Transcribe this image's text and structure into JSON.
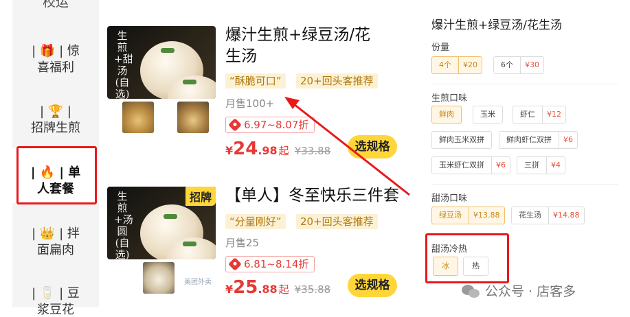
{
  "sidebar": {
    "cut_label": "校运",
    "items": [
      {
        "emoji": "🎁",
        "line1": "惊",
        "line2": "喜福利",
        "active": false
      },
      {
        "emoji": "🏆",
        "line1": "",
        "line2": "招牌生煎",
        "active": false
      },
      {
        "emoji": "🔥",
        "line1": "单",
        "line2": "人套餐",
        "active": true
      },
      {
        "emoji": "👑",
        "line1": "拌",
        "line2": "面扁肉",
        "active": false
      },
      {
        "emoji": "🥛",
        "line1": "豆",
        "line2": "浆豆花",
        "active": false
      }
    ]
  },
  "products": [
    {
      "title_line1": "爆汁生煎+绿豆汤/花",
      "title_line2": "生汤",
      "image_text": "生煎+甜汤(自选)",
      "tags": [
        "“酥脆可口”",
        "20+回头客推荐"
      ],
      "sales": "月售100+",
      "discount": "6.97~8.07折",
      "price_symbol": "¥",
      "price_int": "24",
      "price_dec": ".98",
      "price_unit": "起",
      "price_original": "¥33.88",
      "button": "选规格"
    },
    {
      "badge": "招牌",
      "title_line1": "【单人】冬至快乐三件套",
      "image_text": "生煎+汤圆(自选)",
      "thumb_text": "美团外卖",
      "tags": [
        "“分量刚好”",
        "20+回头客推荐"
      ],
      "sales": "月售25",
      "discount": "6.81~8.14折",
      "price_symbol": "¥",
      "price_int": "25",
      "price_dec": ".88",
      "price_unit": "起",
      "price_original": "¥35.88",
      "button": "选规格"
    }
  ],
  "spec": {
    "title": "爆汁生煎+绿豆汤/花生汤",
    "groups": {
      "portion": {
        "label": "份量",
        "options": [
          {
            "name": "4个",
            "price": "¥20",
            "selected": true
          },
          {
            "name": "6个",
            "price": "¥30",
            "selected": false
          }
        ]
      },
      "flavor": {
        "label": "生煎口味",
        "options": [
          {
            "name": "鲜肉",
            "price": "",
            "selected": true
          },
          {
            "name": "玉米",
            "price": "",
            "selected": false
          },
          {
            "name": "虾仁",
            "price": "¥12",
            "selected": false
          },
          {
            "name": "鲜肉玉米双拼",
            "price": "",
            "selected": false
          },
          {
            "name": "鲜肉虾仁双拼",
            "price": "¥6",
            "selected": false
          },
          {
            "name": "玉米虾仁双拼",
            "price": "¥6",
            "selected": false
          },
          {
            "name": "三拼",
            "price": "¥4",
            "selected": false
          }
        ]
      },
      "soup": {
        "label": "甜汤口味",
        "options": [
          {
            "name": "绿豆汤",
            "price": "¥13.88",
            "selected": true
          },
          {
            "name": "花生汤",
            "price": "¥14.88",
            "selected": false
          }
        ]
      },
      "temperature": {
        "label": "甜汤冷热",
        "options": [
          {
            "name": "冰",
            "price": "",
            "selected": true
          },
          {
            "name": "热",
            "price": "",
            "selected": false
          }
        ]
      }
    }
  },
  "watermark": "公众号 · 店客多",
  "colors": {
    "accent_yellow": "#ffd63a",
    "price_red": "#e53a34",
    "annotation_red": "#e8181b",
    "tag_bg": "#fdf1d4",
    "tag_text": "#b07b14"
  }
}
